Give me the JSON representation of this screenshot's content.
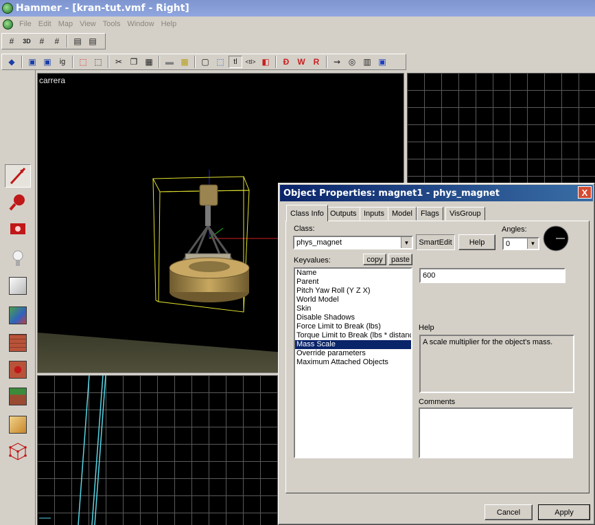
{
  "window": {
    "title": "Hammer - [kran-tut.vmf - Right]"
  },
  "menu": [
    "File",
    "Edit",
    "Map",
    "View",
    "Tools",
    "Window",
    "Help"
  ],
  "viewport3d": {
    "label": "carrera"
  },
  "dialog": {
    "title": "Object Properties: magnet1 - phys_magnet",
    "close": "X",
    "tabs": [
      "Class Info",
      "Outputs",
      "Inputs",
      "Model",
      "Flags",
      "VisGroup"
    ],
    "class_label": "Class:",
    "class_value": "phys_magnet",
    "smartedit": "SmartEdit",
    "help_button": "Help",
    "angles_label": "Angles:",
    "angles_value": "0",
    "keyvalues_label": "Keyvalues:",
    "copy": "copy",
    "paste": "paste",
    "keys": [
      "Name",
      "Parent",
      "Pitch Yaw Roll (Y Z X)",
      "World Model",
      "Skin",
      "Disable Shadows",
      "Force Limit to Break (lbs)",
      "Torque Limit to Break (lbs * distance)",
      "Mass Scale",
      "Override parameters",
      "Maximum Attached Objects"
    ],
    "selected_key_index": 8,
    "value": "600",
    "help_label": "Help",
    "help_text": "A scale multiplier for the object's mass.",
    "comments_label": "Comments",
    "comments_text": "",
    "cancel": "Cancel",
    "apply": "Apply"
  },
  "colors": {
    "title_bar": "#7e95cf",
    "dialog_title": "#0a246a",
    "selection": "#0a246a",
    "grid": "#5a5a5a",
    "cyan_line": "#58d8e8"
  }
}
